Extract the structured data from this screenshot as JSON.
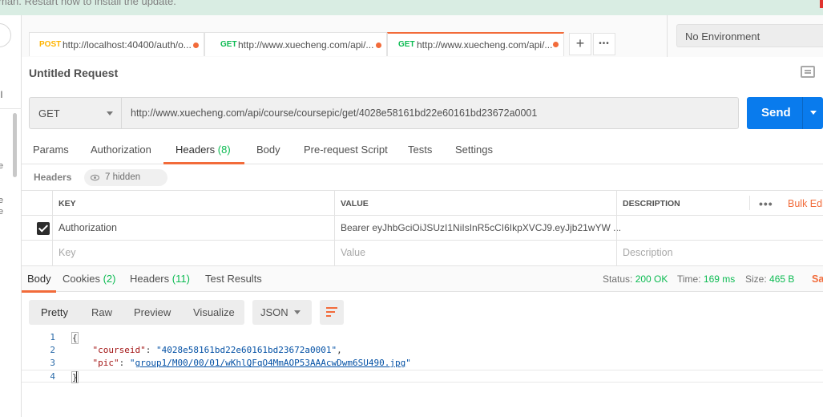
{
  "banner": {
    "text": "man. Restart now to install the update."
  },
  "sidebar": {
    "all_label": "ll",
    "fragments": [
      "e",
      "e",
      "e"
    ]
  },
  "tabs": [
    {
      "method": "POST",
      "url": "http://localhost:40400/auth/o..."
    },
    {
      "method": "GET",
      "url": "http://www.xuecheng.com/api/..."
    },
    {
      "method": "GET",
      "url": "http://www.xuecheng.com/api/..."
    }
  ],
  "tab_controls": {
    "add": "+",
    "more": "•••"
  },
  "environment": {
    "selected": "No Environment"
  },
  "request": {
    "title": "Untitled Request",
    "method": "GET",
    "url": "http://www.xuecheng.com/api/course/coursepic/get/4028e58161bd22e60161bd23672a0001",
    "send_label": "Send"
  },
  "request_tabs": {
    "params": "Params",
    "authorization": "Authorization",
    "headers": "Headers",
    "headers_count": "(8)",
    "body": "Body",
    "prerequest": "Pre-request Script",
    "tests": "Tests",
    "settings": "Settings"
  },
  "headers_section": {
    "label": "Headers",
    "hidden": "7 hidden"
  },
  "headers_table": {
    "columns": {
      "key": "KEY",
      "value": "VALUE",
      "description": "DESCRIPTION"
    },
    "more": "•••",
    "bulk_edit": "Bulk Edi",
    "rows": [
      {
        "key": "Authorization",
        "value": "Bearer eyJhbGciOiJSUzI1NiIsInR5cCI6IkpXVCJ9.eyJjb21wYW ...",
        "description": ""
      }
    ],
    "placeholder": {
      "key": "Key",
      "value": "Value",
      "description": "Description"
    }
  },
  "response_tabs": {
    "body": "Body",
    "cookies": "Cookies",
    "cookies_count": "(2)",
    "headers": "Headers",
    "headers_count": "(11)",
    "test_results": "Test Results"
  },
  "response_status": {
    "status_label": "Status:",
    "status_value": "200 OK",
    "time_label": "Time:",
    "time_value": "169 ms",
    "size_label": "Size:",
    "size_value": "465 B",
    "save": "Sa"
  },
  "response_toolbar": {
    "views": [
      "Pretty",
      "Raw",
      "Preview",
      "Visualize"
    ],
    "format": "JSON"
  },
  "response_body": {
    "lines": [
      {
        "n": "1",
        "open": "{"
      },
      {
        "n": "2",
        "indent": "    ",
        "key": "\"courseid\"",
        "sep": ": ",
        "value": "\"4028e58161bd22e60161bd23672a0001\"",
        "end": ","
      },
      {
        "n": "3",
        "indent": "    ",
        "key": "\"pic\"",
        "sep": ": ",
        "q1": "\"",
        "value_link": "group1/M00/00/01/wKhlQFqO4MmAOP53AAAcwDwm6SU490.jpg",
        "q2": "\""
      },
      {
        "n": "4",
        "close": "}"
      }
    ]
  },
  "colors": {
    "accent": "#f26b3a",
    "send": "#097bed",
    "post": "#ffb400",
    "get": "#0cbb52"
  }
}
